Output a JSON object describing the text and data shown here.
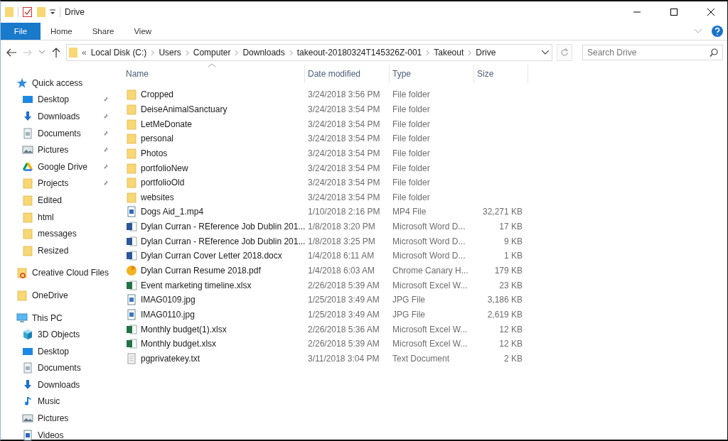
{
  "window": {
    "title": "Drive"
  },
  "ribbon": {
    "tabs": [
      {
        "label": "File",
        "kind": "file"
      },
      {
        "label": "Home",
        "kind": "tab"
      },
      {
        "label": "Share",
        "kind": "tab"
      },
      {
        "label": "View",
        "kind": "tab"
      }
    ]
  },
  "address_bar": {
    "overflow_marker": "«",
    "path": [
      "Local Disk (C:)",
      "Users",
      "Computer",
      "Downloads",
      "takeout-20180324T145326Z-001",
      "Takeout",
      "Drive"
    ]
  },
  "search": {
    "placeholder": "Search Drive"
  },
  "sidebar": {
    "items": [
      {
        "label": "Quick access",
        "kind": "star",
        "children": [
          {
            "label": "Desktop",
            "kind": "desktop",
            "pinned": true
          },
          {
            "label": "Downloads",
            "kind": "download",
            "pinned": true
          },
          {
            "label": "Documents",
            "kind": "document",
            "pinned": true
          },
          {
            "label": "Pictures",
            "kind": "pictures",
            "pinned": true
          },
          {
            "label": "Google Drive",
            "kind": "triangle",
            "pinned": true
          },
          {
            "label": "Projects",
            "kind": "folder",
            "pinned": true
          },
          {
            "label": "Edited",
            "kind": "folder",
            "pinned": false
          },
          {
            "label": "html",
            "kind": "folder",
            "pinned": false
          },
          {
            "label": "messages",
            "kind": "folder",
            "pinned": false
          },
          {
            "label": "Resized",
            "kind": "folder",
            "pinned": false
          }
        ]
      },
      {
        "label": "Creative Cloud Files",
        "kind": "cloudfolder"
      },
      {
        "label": "OneDrive",
        "kind": "folder"
      },
      {
        "label": "This PC",
        "kind": "pc",
        "children": [
          {
            "label": "3D Objects",
            "kind": "cube",
            "pinned": false
          },
          {
            "label": "Desktop",
            "kind": "desktop",
            "pinned": false
          },
          {
            "label": "Documents",
            "kind": "document",
            "pinned": false
          },
          {
            "label": "Downloads",
            "kind": "download",
            "pinned": false
          },
          {
            "label": "Music",
            "kind": "music",
            "pinned": false
          },
          {
            "label": "Pictures",
            "kind": "pictures",
            "pinned": false
          },
          {
            "label": "Videos",
            "kind": "video",
            "pinned": false
          }
        ]
      }
    ]
  },
  "table": {
    "columns": [
      {
        "label": "Name",
        "sorted": true
      },
      {
        "label": "Date modified",
        "sorted": false
      },
      {
        "label": "Type",
        "sorted": false
      },
      {
        "label": "Size",
        "sorted": false
      }
    ],
    "rows": [
      {
        "name": "Cropped",
        "kind": "folder",
        "date": "3/24/2018 3:56 PM",
        "type": "File folder"
      },
      {
        "name": "DeiseAnimalSanctuary",
        "kind": "folder",
        "date": "3/24/2018 3:54 PM",
        "type": "File folder"
      },
      {
        "name": "LetMeDonate",
        "kind": "folder",
        "date": "3/24/2018 3:54 PM",
        "type": "File folder"
      },
      {
        "name": "personal",
        "kind": "folder",
        "date": "3/24/2018 3:54 PM",
        "type": "File folder"
      },
      {
        "name": "Photos",
        "kind": "folder",
        "date": "3/24/2018 3:54 PM",
        "type": "File folder"
      },
      {
        "name": "portfolioNew",
        "kind": "folder",
        "date": "3/24/2018 3:54 PM",
        "type": "File folder"
      },
      {
        "name": "portfolioOld",
        "kind": "folder",
        "date": "3/24/2018 3:54 PM",
        "type": "File folder"
      },
      {
        "name": "websites",
        "kind": "folder",
        "date": "3/24/2018 3:54 PM",
        "type": "File folder"
      },
      {
        "name": "Dogs Aid_1.mp4",
        "kind": "video",
        "date": "1/10/2018 2:16 PM",
        "type": "MP4 File",
        "size": "32,271 KB"
      },
      {
        "name": "Dylan Curran - REference Job Dublin 201...",
        "kind": "word",
        "date": "1/8/2018 3:20 PM",
        "type": "Microsoft Word D...",
        "size": "17 KB"
      },
      {
        "name": "Dylan Curran - REference Job Dublin 201...",
        "kind": "word",
        "date": "1/8/2018 3:25 PM",
        "type": "Microsoft Word D...",
        "size": "9 KB"
      },
      {
        "name": "Dylan Curran Cover Letter 2018.docx",
        "kind": "word",
        "date": "1/4/2018 6:11 AM",
        "type": "Microsoft Word D...",
        "size": "1 KB"
      },
      {
        "name": "Dylan Curran Resume 2018.pdf",
        "kind": "browser",
        "date": "1/4/2018 6:03 AM",
        "type": "Chrome Canary H...",
        "size": "179 KB"
      },
      {
        "name": "Event marketing timeline.xlsx",
        "kind": "excel",
        "date": "2/26/2018 5:39 AM",
        "type": "Microsoft Excel W...",
        "size": "23 KB"
      },
      {
        "name": "IMAG0109.jpg",
        "kind": "image",
        "date": "1/25/2018 3:49 AM",
        "type": "JPG File",
        "size": "3,186 KB"
      },
      {
        "name": "IMAG0110.jpg",
        "kind": "image",
        "date": "1/25/2018 3:49 AM",
        "type": "JPG File",
        "size": "2,619 KB"
      },
      {
        "name": "Monthly budget(1).xlsx",
        "kind": "excel",
        "date": "2/26/2018 5:36 AM",
        "type": "Microsoft Excel W...",
        "size": "12 KB"
      },
      {
        "name": "Monthly budget.xlsx",
        "kind": "excel",
        "date": "2/26/2018 5:39 AM",
        "type": "Microsoft Excel W...",
        "size": "12 KB"
      },
      {
        "name": "pgprivatekey.txt",
        "kind": "text",
        "date": "3/11/2018 3:04 PM",
        "type": "Text Document",
        "size": "2 KB"
      }
    ]
  }
}
